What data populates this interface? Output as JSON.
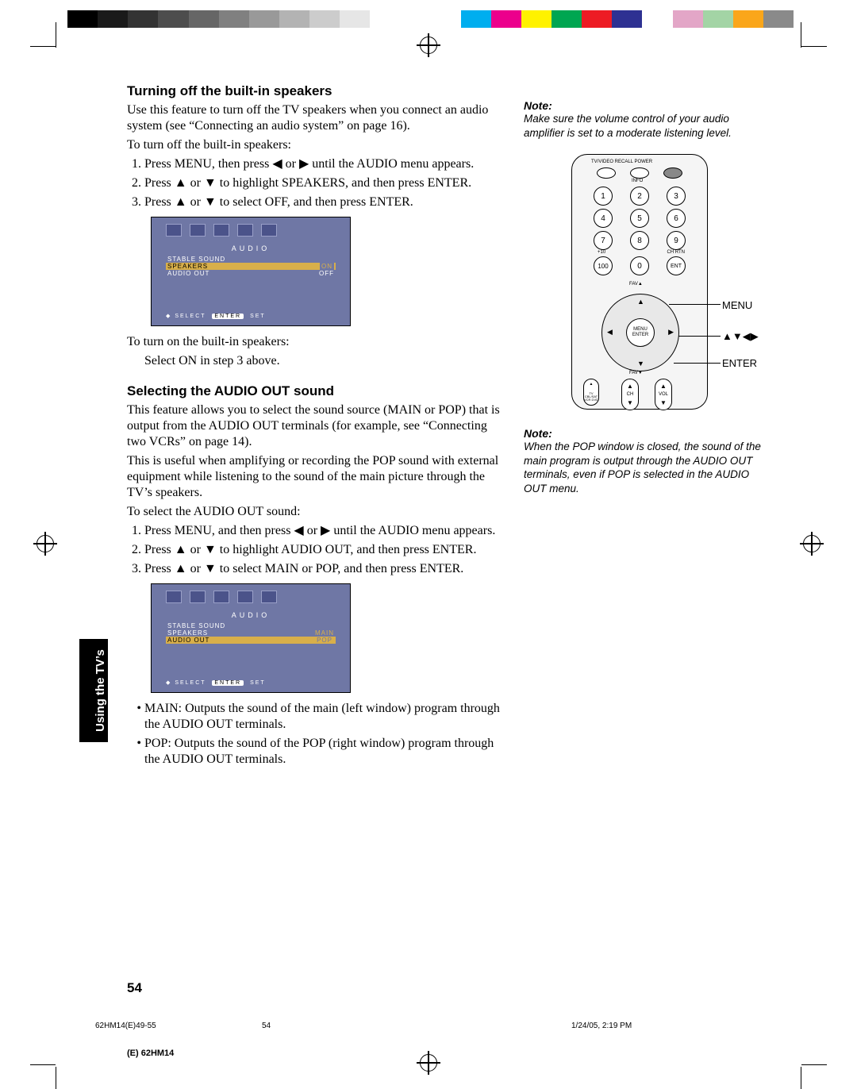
{
  "section1": {
    "heading": "Turning off the built-in speakers",
    "intro": "Use this feature to turn off the TV speakers when you connect an audio system (see “Connecting an audio system” on page 16).",
    "lead": "To turn off the built-in speakers:",
    "step1": "Press MENU, then press ◀ or ▶ until the AUDIO menu appears.",
    "step2": "Press ▲ or ▼ to highlight SPEAKERS, and then press ENTER.",
    "step3": "Press ▲ or ▼ to select OFF, and then press ENTER.",
    "post1": "To turn on the built-in speakers:",
    "post2": "Select ON in step 3 above."
  },
  "section2": {
    "heading": "Selecting the AUDIO OUT sound",
    "intro": "This feature allows you to select the sound source (MAIN or POP) that is output from the AUDIO OUT terminals (for example, see “Connecting two VCRs” on page 14).",
    "para2": "This is useful when amplifying or recording the POP sound with external equipment while listening to the sound of the main picture through the TV’s speakers.",
    "lead": "To select the AUDIO OUT sound:",
    "step1": "Press MENU, and then press ◀ or ▶ until the AUDIO menu appears.",
    "step2": "Press ▲ or ▼ to highlight AUDIO OUT, and then press ENTER.",
    "step3": "Press ▲ or ▼ to select MAIN or POP, and then press ENTER.",
    "b1": "MAIN: Outputs the sound of the main (left window) program through the AUDIO OUT terminals.",
    "b2": "POP: Outputs the sound of the POP (right window) program through the AUDIO OUT terminals."
  },
  "osd": {
    "title": "AUDIO",
    "rows": [
      {
        "l": "STABLE SOUND",
        "r": ""
      },
      {
        "l": "SPEAKERS",
        "r": "ON"
      },
      {
        "l": "AUDIO OUT",
        "r": "OFF"
      }
    ],
    "footer_select": "SELECT",
    "footer_enter": "ENTER",
    "footer_set": "SET"
  },
  "osd2_rows": [
    {
      "l": "STABLE SOUND",
      "r": ""
    },
    {
      "l": "SPEAKERS",
      "r": "MAIN"
    },
    {
      "l": "AUDIO OUT",
      "r": "POP"
    }
  ],
  "notes": {
    "head": "Note:",
    "n1": "Make sure the volume control of your audio amplifier is set to a moderate listening level.",
    "n2": "When the POP window is closed, the sound of the main program is output through the AUDIO OUT terminals, even if POP is selected in the AUDIO OUT menu."
  },
  "remote": {
    "callout_menu": "MENU",
    "callout_arrows": "▲▼◀▶",
    "callout_enter": "ENTER",
    "toprow": "TV/VIDEO  RECALL  POWER",
    "info": "INFO",
    "charge": "+10",
    "chrtn": "CH RTN",
    "ent": "ENT",
    "fav": "FAV▲",
    "center": "MENU\nENTER",
    "favd": "FAV▼",
    "sel1": "TV\nCBL/SAT\nVCR\nDVD",
    "sel2": "CH",
    "sel3": "VOL"
  },
  "sidetab": "Using the TV’s Features",
  "pagenum": "54",
  "footerL": "62HM14(E)49-55",
  "footerC": "54",
  "footerR": "1/24/05, 2:19 PM",
  "model": "(E) 62HM14"
}
